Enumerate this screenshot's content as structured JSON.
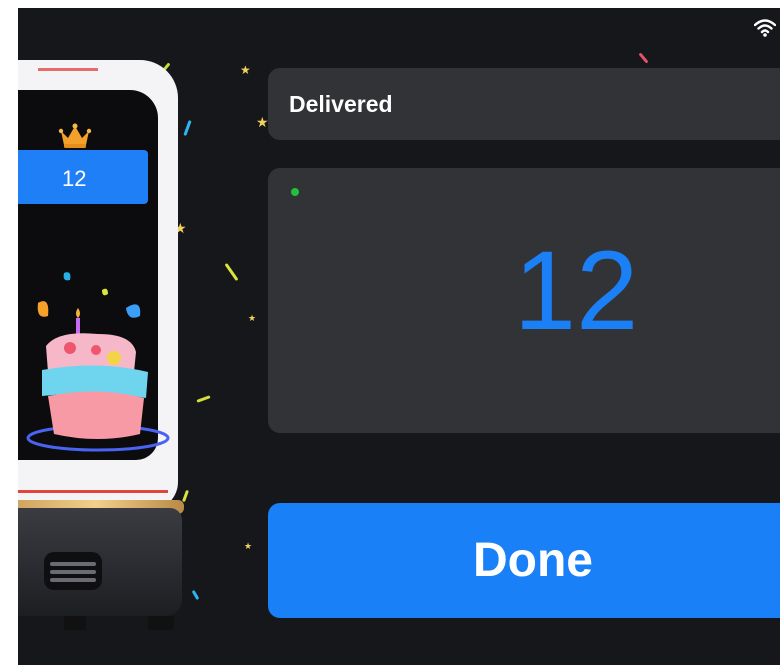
{
  "header": {
    "wifi_icon": "wifi-icon"
  },
  "robot": {
    "crown_icon": "crown-icon",
    "table_number": "12",
    "cake_icon": "birthday-cake-icon"
  },
  "status": {
    "label": "Delivered",
    "indicator_color": "#21c13a"
  },
  "order": {
    "number": "12",
    "number_color": "#1b7ff5"
  },
  "actions": {
    "done_label": "Done",
    "done_color": "#1a80f7"
  }
}
